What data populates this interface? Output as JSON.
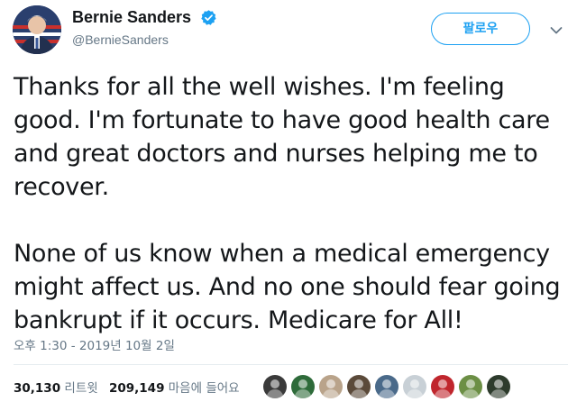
{
  "author": {
    "display_name": "Bernie Sanders",
    "handle": "@BernieSanders",
    "verified": true,
    "avatar_icon": "profile-photo"
  },
  "actions": {
    "follow_label": "팔로우",
    "menu_icon": "chevron-down-icon"
  },
  "tweet": {
    "paragraphs": [
      "Thanks for all the well wishes. I'm feeling good. I'm fortunate to have good health care and great doctors and nurses helping me to recover.",
      "None of us know when a medical emergency might affect us. And no one should fear going bankrupt if it occurs. Medicare for All!"
    ],
    "timestamp": "오후 1:30 - 2019년 10월 2일"
  },
  "stats": {
    "retweets_count": "30,130",
    "retweets_label": "리트윗",
    "likes_count": "209,149",
    "likes_label": "마음에 들어요"
  },
  "likers": [
    {
      "icon": "liker-avatar-1",
      "color": "#3a3a3a"
    },
    {
      "icon": "liker-avatar-2",
      "color": "#2e6b3a"
    },
    {
      "icon": "liker-avatar-3",
      "color": "#b9a38a"
    },
    {
      "icon": "liker-avatar-4",
      "color": "#5b4a3a"
    },
    {
      "icon": "liker-avatar-5",
      "color": "#4a6a8a"
    },
    {
      "icon": "liker-avatar-6",
      "color": "#c8d0d6"
    },
    {
      "icon": "liker-avatar-7",
      "color": "#c0262d"
    },
    {
      "icon": "liker-avatar-8",
      "color": "#6c8f45"
    },
    {
      "icon": "liker-avatar-9",
      "color": "#2d3b2c"
    }
  ],
  "colors": {
    "accent": "#1da1f2",
    "text": "#14171a",
    "muted": "#657786"
  }
}
